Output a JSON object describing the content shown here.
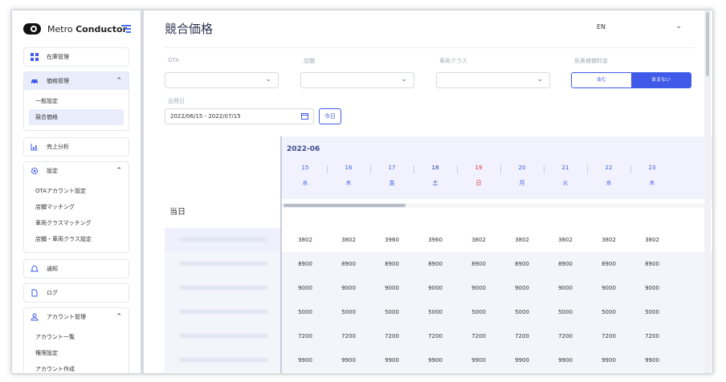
{
  "brand": {
    "name_regular": "Metro ",
    "name_bold": "Conductor"
  },
  "sidebar": {
    "inventory": "在庫管理",
    "pricing": {
      "label": "価格管理",
      "sub": [
        "一般設定",
        "競合価格"
      ]
    },
    "sales": "売上分析",
    "settings": {
      "label": "設定",
      "sub": [
        "OTAアカウント設定",
        "店舗マッチング",
        "車両クラスマッチング",
        "店舗・車両クラス設定"
      ]
    },
    "notifications": "通知",
    "logs": "ログ",
    "account": {
      "label": "アカウント管理",
      "sub": [
        "アカウント一覧",
        "権限設定",
        "アカウント作成"
      ]
    }
  },
  "header": {
    "title": "競合価格",
    "language": "EN"
  },
  "filters": {
    "ota_label": "OTA",
    "store_label": "店舗",
    "vehicle_class_label": "車両クラス",
    "insurance_label": "免責補償料金",
    "insurance_options": [
      "含む",
      "含まない"
    ],
    "insurance_selected": "含まない",
    "date_label": "出発日",
    "date_range": "2022/06/15 - 2022/07/15",
    "today_button": "今日"
  },
  "table": {
    "month": "2022-06",
    "today_label": "当日",
    "dates": [
      {
        "d": "15",
        "w": "水",
        "color": "#3f5ae8"
      },
      {
        "d": "16",
        "w": "木",
        "color": "#3f5ae8"
      },
      {
        "d": "17",
        "w": "金",
        "color": "#3f5ae8"
      },
      {
        "d": "18",
        "w": "土",
        "color": "#1f3fa8"
      },
      {
        "d": "19",
        "w": "日",
        "color": "#e0293a"
      },
      {
        "d": "20",
        "w": "月",
        "color": "#3f5ae8"
      },
      {
        "d": "21",
        "w": "火",
        "color": "#3f5ae8"
      },
      {
        "d": "22",
        "w": "水",
        "color": "#3f5ae8"
      },
      {
        "d": "23",
        "w": "木",
        "color": "#3f5ae8"
      }
    ],
    "rows": [
      [
        "3802",
        "3802",
        "3960",
        "3960",
        "3802",
        "3802",
        "3802",
        "3802",
        "3802"
      ],
      [
        "8900",
        "8900",
        "8900",
        "8900",
        "8900",
        "8900",
        "8900",
        "8900",
        "8900"
      ],
      [
        "9000",
        "9000",
        "9000",
        "9000",
        "9000",
        "9000",
        "9000",
        "9000",
        "9000"
      ],
      [
        "5000",
        "5000",
        "5000",
        "5000",
        "5000",
        "5000",
        "5000",
        "5000",
        "5000"
      ],
      [
        "7200",
        "7200",
        "7200",
        "7200",
        "7200",
        "7200",
        "7200",
        "7200",
        "7200"
      ],
      [
        "9900",
        "9900",
        "9900",
        "9900",
        "9900",
        "9900",
        "9900",
        "9900",
        "9900"
      ]
    ]
  }
}
